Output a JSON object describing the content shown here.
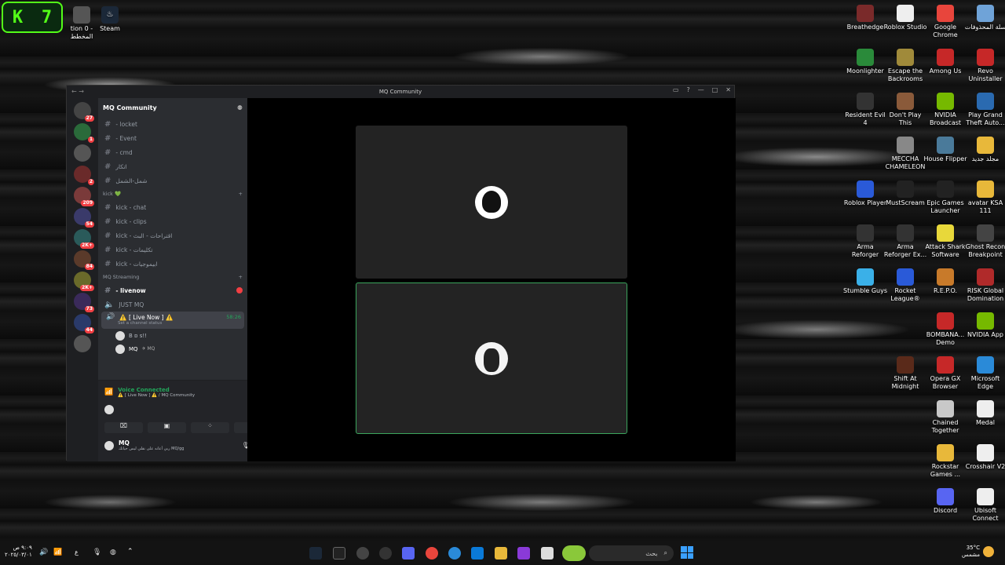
{
  "widget": {
    "k": "K",
    "n": "7"
  },
  "desktop_left": [
    {
      "label": "tion 0 - المخطط",
      "color": "#555"
    },
    {
      "label": "Steam",
      "color": "#1b2838"
    }
  ],
  "desktop_right": [
    {
      "label": "Breathedge",
      "color": "#7a2a2a"
    },
    {
      "label": "Roblox Studio",
      "color": "#eee"
    },
    {
      "label": "Google Chrome",
      "color": "#e8453c"
    },
    {
      "label": "سلة المحذوفات",
      "color": "#6fa3d8"
    },
    {
      "label": "Moonlighter",
      "color": "#2a8a3a"
    },
    {
      "label": "Escape the Backrooms",
      "color": "#a08a3a"
    },
    {
      "label": "Among Us",
      "color": "#c62828"
    },
    {
      "label": "Revo Uninstaller",
      "color": "#c62828"
    },
    {
      "label": "Resident Evil 4",
      "color": "#333"
    },
    {
      "label": "Don't Play This",
      "color": "#8a5a3a"
    },
    {
      "label": "NVIDIA Broadcast",
      "color": "#76b900"
    },
    {
      "label": "Play Grand Theft Auto...",
      "color": "#2a6ab0"
    },
    {
      "label": "",
      "color": ""
    },
    {
      "label": "MECCHA CHAMELEON",
      "color": "#888"
    },
    {
      "label": "House Flipper",
      "color": "#4a7a9a"
    },
    {
      "label": "مجلد جديد",
      "color": "#e8b83a"
    },
    {
      "label": "Roblox Player",
      "color": "#2a5ad8"
    },
    {
      "label": "MustScream",
      "color": "#222"
    },
    {
      "label": "Epic Games Launcher",
      "color": "#222"
    },
    {
      "label": "avatar KSA 111",
      "color": "#e8b83a"
    },
    {
      "label": "Arma Reforger",
      "color": "#333"
    },
    {
      "label": "Arma Reforger Ex...",
      "color": "#333"
    },
    {
      "label": "Attack Shark Software",
      "color": "#e8d83a"
    },
    {
      "label": "Ghost Recon Breakpoint",
      "color": "#444"
    },
    {
      "label": "Stumble Guys",
      "color": "#3ab0e8"
    },
    {
      "label": "Rocket League®",
      "color": "#2a5ad8"
    },
    {
      "label": "R.E.P.O.",
      "color": "#c87a2a"
    },
    {
      "label": "RISK Global Domination",
      "color": "#b02a2a"
    },
    {
      "label": "",
      "color": ""
    },
    {
      "label": "",
      "color": ""
    },
    {
      "label": "BOMBANA... Demo",
      "color": "#c62828"
    },
    {
      "label": "NVIDIA App",
      "color": "#76b900"
    },
    {
      "label": "",
      "color": ""
    },
    {
      "label": "Shift At Midnight",
      "color": "#5a2a1a"
    },
    {
      "label": "Opera GX Browser",
      "color": "#c62828"
    },
    {
      "label": "Microsoft Edge",
      "color": "#2a8ad8"
    },
    {
      "label": "",
      "color": ""
    },
    {
      "label": "",
      "color": ""
    },
    {
      "label": "Chained Together",
      "color": "#c8c8c8"
    },
    {
      "label": "Medal",
      "color": "#eee"
    },
    {
      "label": "",
      "color": ""
    },
    {
      "label": "",
      "color": ""
    },
    {
      "label": "Rockstar Games ...",
      "color": "#e8b83a"
    },
    {
      "label": "Crosshair V2",
      "color": "#eee"
    },
    {
      "label": "",
      "color": ""
    },
    {
      "label": "",
      "color": ""
    },
    {
      "label": "Discord",
      "color": "#5865f2"
    },
    {
      "label": "Ubisoft Connect",
      "color": "#eee"
    }
  ],
  "window": {
    "title": "MQ Community"
  },
  "servers": [
    {
      "badge": "27"
    },
    {
      "badge": "1"
    },
    {
      "badge": ""
    },
    {
      "badge": "2"
    },
    {
      "badge": "209"
    },
    {
      "badge": "54"
    },
    {
      "badge": "2K+"
    },
    {
      "badge": "84"
    },
    {
      "badge": "2K+"
    },
    {
      "badge": "73"
    },
    {
      "badge": "44"
    },
    {
      "badge": ""
    }
  ],
  "server_name": "MQ Community",
  "channels_top": [
    {
      "name": "- locket"
    },
    {
      "name": "- Event"
    },
    {
      "name": "- cmd"
    },
    {
      "name": "اتكار"
    },
    {
      "name": "شمل-الشمل"
    }
  ],
  "cat_kick": "kick 💚",
  "channels_kick": [
    {
      "name": "kick - chat"
    },
    {
      "name": "kick - clips"
    },
    {
      "name": "kick - اقتراحات - البث"
    },
    {
      "name": "kick - تكليمات"
    },
    {
      "name": "kick - ابيموجيات"
    }
  ],
  "cat_stream": "MQ Streaming",
  "ch_livenow": "- livenow",
  "ch_justmq": "JUST MQ",
  "ch_active": {
    "name": "⚠️ [ Live Now ] ⚠️",
    "status": "Set a channel status",
    "timer": "58:26"
  },
  "voice_users": [
    {
      "name": "B ɒ s!!"
    },
    {
      "name": "MQ"
    }
  ],
  "voice_user_tag": "MQ",
  "panel": {
    "connected": "Voice Connected",
    "where": "⚠️ [ Live Now ] ⚠️ / MQ Community",
    "user": "MQ",
    "status": "ربي أعانه على نقلي ليس حياتك MQ/gg"
  },
  "taskbar": {
    "search": "بحث",
    "weather_temp": "35°C",
    "weather_desc": "مشمس",
    "time": "٩:٠٩ ص",
    "date": "٢٠٢٥/٠٣/٠١",
    "lang": "ع"
  },
  "colors": {
    "accent": "#5865f2",
    "connected": "#23a55a",
    "tile_border": "#3ba55d"
  }
}
